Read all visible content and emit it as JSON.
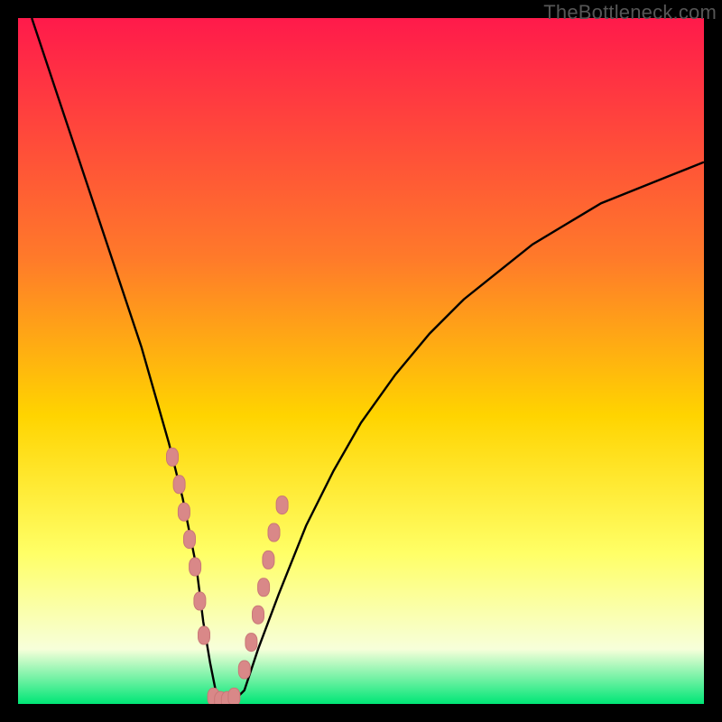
{
  "watermark": "TheBottleneck.com",
  "colors": {
    "bg": "#000000",
    "grad_top": "#ff1a4b",
    "grad_mid1": "#ff7a2a",
    "grad_mid2": "#ffd400",
    "grad_low1": "#ffff66",
    "grad_low2": "#f7ffda",
    "grad_bottom": "#00e676",
    "curve": "#000000",
    "marker_fill": "#d98888",
    "marker_stroke": "#c97777"
  },
  "chart_data": {
    "type": "line",
    "title": "",
    "xlabel": "",
    "ylabel": "",
    "xlim": [
      0,
      100
    ],
    "ylim": [
      0,
      100
    ],
    "series": [
      {
        "name": "bottleneck-curve",
        "x": [
          2,
          4,
          6,
          8,
          10,
          12,
          14,
          16,
          18,
          20,
          22,
          24,
          26,
          27,
          28,
          29,
          30,
          31,
          33,
          35,
          38,
          42,
          46,
          50,
          55,
          60,
          65,
          70,
          75,
          80,
          85,
          90,
          95,
          100
        ],
        "y": [
          100,
          94,
          88,
          82,
          76,
          70,
          64,
          58,
          52,
          45,
          38,
          30,
          20,
          12,
          6,
          1,
          0,
          0,
          2,
          8,
          16,
          26,
          34,
          41,
          48,
          54,
          59,
          63,
          67,
          70,
          73,
          75,
          77,
          79
        ]
      }
    ],
    "markers": {
      "name": "highlight-points",
      "x": [
        22.5,
        23.5,
        24.2,
        25.0,
        25.8,
        26.5,
        27.1,
        28.5,
        29.5,
        30.5,
        31.5,
        33.0,
        34.0,
        35.0,
        35.8,
        36.5,
        37.3,
        38.5
      ],
      "y": [
        36.0,
        32.0,
        28.0,
        24.0,
        20.0,
        15.0,
        10.0,
        1.0,
        0.5,
        0.5,
        1.0,
        5.0,
        9.0,
        13.0,
        17.0,
        21.0,
        25.0,
        29.0
      ]
    }
  }
}
